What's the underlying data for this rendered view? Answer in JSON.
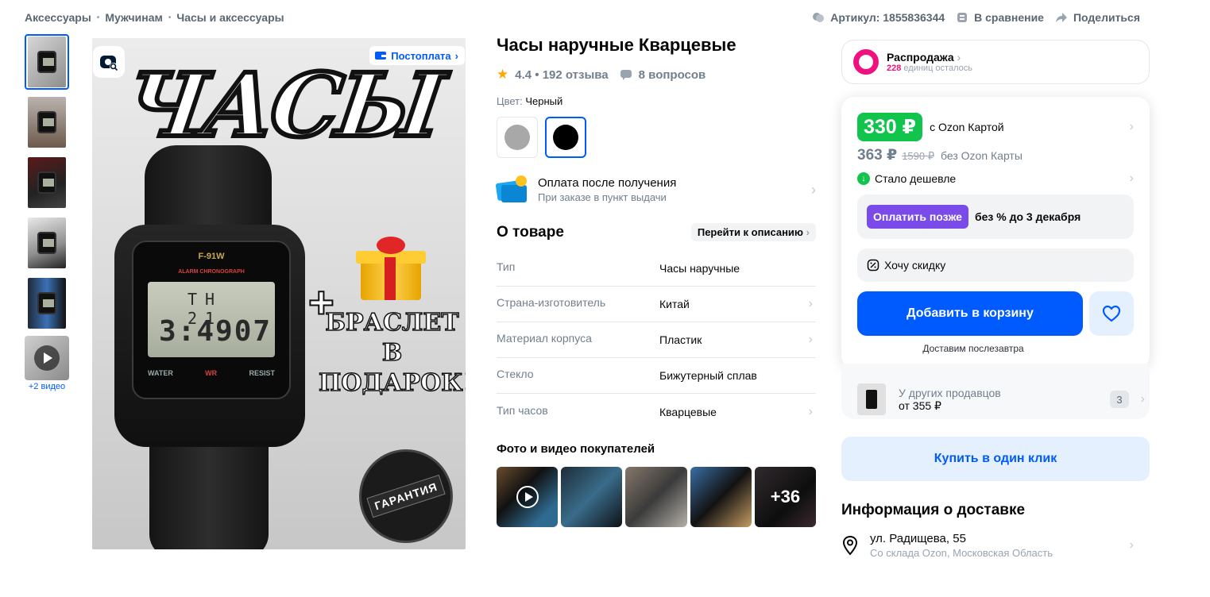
{
  "breadcrumb": [
    "Аксессуары",
    "Мужчинам",
    "Часы и аксессуары"
  ],
  "breadcrumb_separator": "•",
  "toplinks": {
    "article": "Артикул: 1855836344",
    "compare": "В сравнение",
    "share": "Поделиться"
  },
  "gallery": {
    "video_caption": "+2 видео",
    "postpay_badge": "Постоплата",
    "art_title": "ЧАСЫ",
    "art_brand": "F-91W",
    "art_chrono": "ALARM CHRONOGRAPH",
    "art_lcd_day": "TH 21",
    "art_lcd_time": "3:4907",
    "art_wr": [
      "WATER",
      "WR",
      "RESIST"
    ],
    "art_plus": "+",
    "art_gift_text": "БРАСЛЕТ В ПОДАРОК!",
    "art_seal": "ГАРАНТИЯ"
  },
  "product": {
    "title": "Часы наручные Кварцевые",
    "rating": "4.4 • 192 отзыва",
    "questions": "8 вопросов",
    "color_label": "Цвет:",
    "color_value": "Черный",
    "swatches": [
      {
        "color": "#a8a8a8",
        "selected": false
      },
      {
        "color": "#000000",
        "selected": true
      }
    ],
    "payment_title": "Оплата после получения",
    "payment_sub": "При заказе в пункт выдачи",
    "about_title": "О товаре",
    "about_link": "Перейти к описанию",
    "specs": [
      {
        "k": "Тип",
        "v": "Часы наручные"
      },
      {
        "k": "Страна-изготовитель",
        "v": "Китай"
      },
      {
        "k": "Материал корпуса",
        "v": "Пластик"
      },
      {
        "k": "Стекло",
        "v": "Бижутерный сплав"
      },
      {
        "k": "Тип часов",
        "v": "Кварцевые"
      }
    ],
    "ugc_title": "Фото и видео покупателей",
    "ugc_more": "+36"
  },
  "buy": {
    "sale_title": "Распродажа",
    "sale_count": "228",
    "sale_left": "единиц осталось",
    "price_card": "330 ₽",
    "price_card_label": "с Ozon Картой",
    "price_regular": "363 ₽",
    "price_old": "1590 ₽",
    "price_regular_label": "без Ozon Карты",
    "cheaper": "Стало дешевле",
    "paylater_btn": "Оплатить позже",
    "paylater_text": "без % до 3 декабря",
    "discount": "Хочу скидку",
    "add_to_cart": "Добавить в корзину",
    "delivery_note": "Доставим послезавтра",
    "others_label": "У других продавцов",
    "others_price": "от 355 ₽",
    "others_count": "3",
    "one_click": "Купить в один клик",
    "delivery_info_title": "Информация о доставке",
    "address": "ул. Радищева, 55",
    "address_sub": "Со склада Ozon, Московская Область"
  },
  "colors": {
    "accent": "#005bff",
    "green": "#10c44c",
    "pink": "#f1117e",
    "purple": "#7a4be8"
  }
}
